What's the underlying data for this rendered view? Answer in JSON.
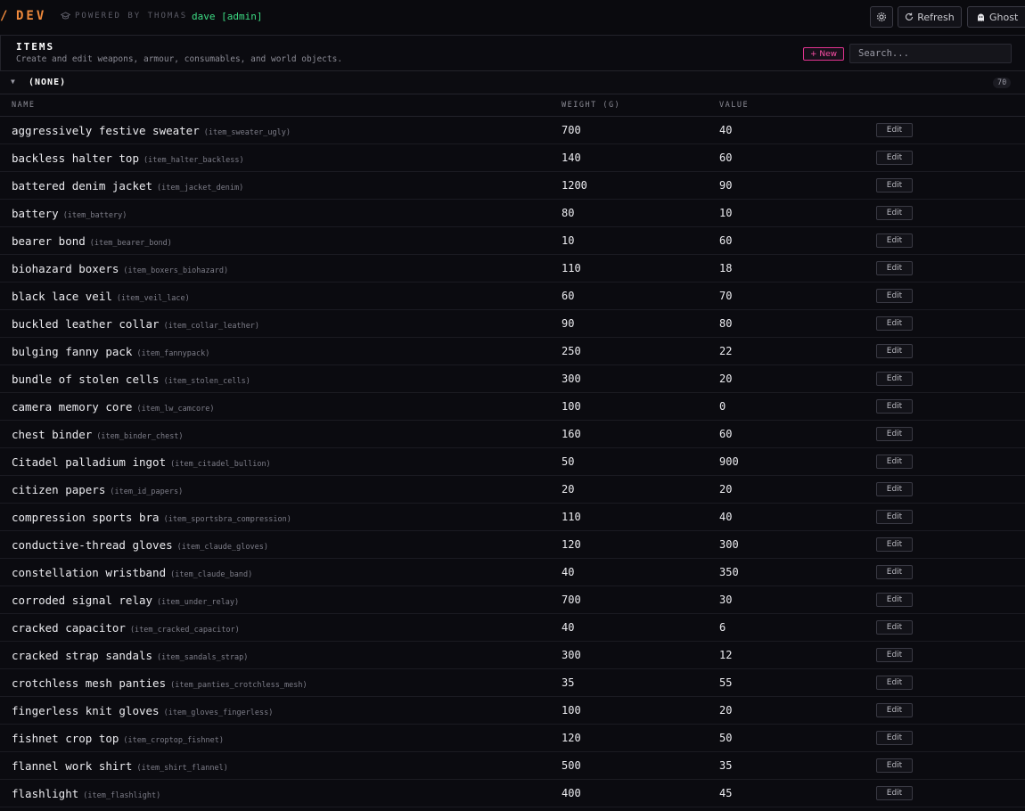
{
  "header": {
    "brand_mark": "/",
    "brand": "DEV",
    "powered_by": "POWERED BY THOMAS",
    "user": "dave [admin]",
    "refresh_label": "Refresh",
    "ghost_label": "Ghost",
    "accent": "#f08a3c",
    "user_color": "#3ddc84"
  },
  "panel": {
    "title": "ITEMS",
    "subtitle": "Create and edit weapons, armour, consumables, and world objects.",
    "new_label": "+ New",
    "search_placeholder": "Search...",
    "new_color": "#ff4fa8"
  },
  "group": {
    "label": "(NONE)",
    "count": "70"
  },
  "columns": {
    "name": "NAME",
    "weight": "WEIGHT (G)",
    "value": "VALUE"
  },
  "edit_label": "Edit",
  "rows": [
    {
      "name": "aggressively festive sweater",
      "id": "(item_sweater_ugly)",
      "weight": "700",
      "value": "40"
    },
    {
      "name": "backless halter top",
      "id": "(item_halter_backless)",
      "weight": "140",
      "value": "60"
    },
    {
      "name": "battered denim jacket",
      "id": "(item_jacket_denim)",
      "weight": "1200",
      "value": "90"
    },
    {
      "name": "battery",
      "id": "(item_battery)",
      "weight": "80",
      "value": "10"
    },
    {
      "name": "bearer bond",
      "id": "(item_bearer_bond)",
      "weight": "10",
      "value": "60"
    },
    {
      "name": "biohazard boxers",
      "id": "(item_boxers_biohazard)",
      "weight": "110",
      "value": "18"
    },
    {
      "name": "black lace veil",
      "id": "(item_veil_lace)",
      "weight": "60",
      "value": "70"
    },
    {
      "name": "buckled leather collar",
      "id": "(item_collar_leather)",
      "weight": "90",
      "value": "80"
    },
    {
      "name": "bulging fanny pack",
      "id": "(item_fannypack)",
      "weight": "250",
      "value": "22"
    },
    {
      "name": "bundle of stolen cells",
      "id": "(item_stolen_cells)",
      "weight": "300",
      "value": "20"
    },
    {
      "name": "camera memory core",
      "id": "(item_lw_camcore)",
      "weight": "100",
      "value": "0"
    },
    {
      "name": "chest binder",
      "id": "(item_binder_chest)",
      "weight": "160",
      "value": "60"
    },
    {
      "name": "Citadel palladium ingot",
      "id": "(item_citadel_bullion)",
      "weight": "50",
      "value": "900"
    },
    {
      "name": "citizen papers",
      "id": "(item_id_papers)",
      "weight": "20",
      "value": "20"
    },
    {
      "name": "compression sports bra",
      "id": "(item_sportsbra_compression)",
      "weight": "110",
      "value": "40"
    },
    {
      "name": "conductive-thread gloves",
      "id": "(item_claude_gloves)",
      "weight": "120",
      "value": "300"
    },
    {
      "name": "constellation wristband",
      "id": "(item_claude_band)",
      "weight": "40",
      "value": "350"
    },
    {
      "name": "corroded signal relay",
      "id": "(item_under_relay)",
      "weight": "700",
      "value": "30"
    },
    {
      "name": "cracked capacitor",
      "id": "(item_cracked_capacitor)",
      "weight": "40",
      "value": "6"
    },
    {
      "name": "cracked strap sandals",
      "id": "(item_sandals_strap)",
      "weight": "300",
      "value": "12"
    },
    {
      "name": "crotchless mesh panties",
      "id": "(item_panties_crotchless_mesh)",
      "weight": "35",
      "value": "55"
    },
    {
      "name": "fingerless knit gloves",
      "id": "(item_gloves_fingerless)",
      "weight": "100",
      "value": "20"
    },
    {
      "name": "fishnet crop top",
      "id": "(item_croptop_fishnet)",
      "weight": "120",
      "value": "50"
    },
    {
      "name": "flannel work shirt",
      "id": "(item_shirt_flannel)",
      "weight": "500",
      "value": "35"
    },
    {
      "name": "flashlight",
      "id": "(item_flashlight)",
      "weight": "400",
      "value": "45"
    }
  ]
}
